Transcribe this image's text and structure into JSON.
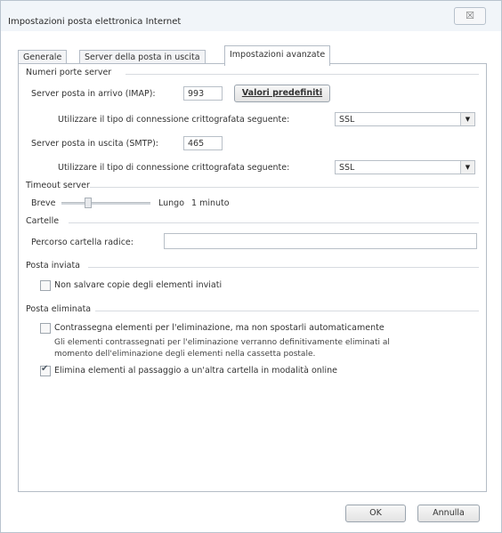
{
  "window": {
    "title": "Impostazioni posta elettronica Internet",
    "close_label": "☒"
  },
  "tabs": [
    {
      "label": "Generale"
    },
    {
      "label": "Server della posta in uscita"
    },
    {
      "label": "Impostazioni avanzate"
    }
  ],
  "server_ports": {
    "group_title": "Numeri porte server",
    "imap_label": "Server posta in arrivo (IMAP):",
    "imap_value": "993",
    "defaults_button": "Valori predefiniti",
    "imap_encryption_label": "Utilizzare il tipo di connessione crittografata seguente:",
    "imap_encryption_value": "SSL",
    "smtp_label": "Server posta in uscita (SMTP):",
    "smtp_value": "465",
    "smtp_encryption_label": "Utilizzare il tipo di connessione crittografata seguente:",
    "smtp_encryption_value": "SSL"
  },
  "timeout": {
    "group_title": "Timeout server",
    "short_label": "Breve",
    "long_label": "Lungo",
    "value": "1 minuto"
  },
  "folders": {
    "group_title": "Cartelle",
    "root_path_label": "Percorso cartella radice:",
    "root_path_value": ""
  },
  "sent": {
    "group_title": "Posta inviata",
    "no_copy_label": "Non salvare copie degli elementi inviati",
    "no_copy_checked": false
  },
  "deleted": {
    "group_title": "Posta eliminata",
    "mark_label": "Contrassegna elementi per l'eliminazione, ma non spostarli automaticamente",
    "mark_checked": false,
    "note_line1": "Gli elementi contrassegnati per l'eliminazione verranno definitivamente eliminati al",
    "note_line2": "momento dell'eliminazione degli elementi nella cassetta postale.",
    "purge_label": "Elimina elementi al passaggio a un'altra cartella in modalità online",
    "purge_checked": true
  },
  "footer": {
    "ok_label": "OK",
    "cancel_label": "Annulla"
  }
}
